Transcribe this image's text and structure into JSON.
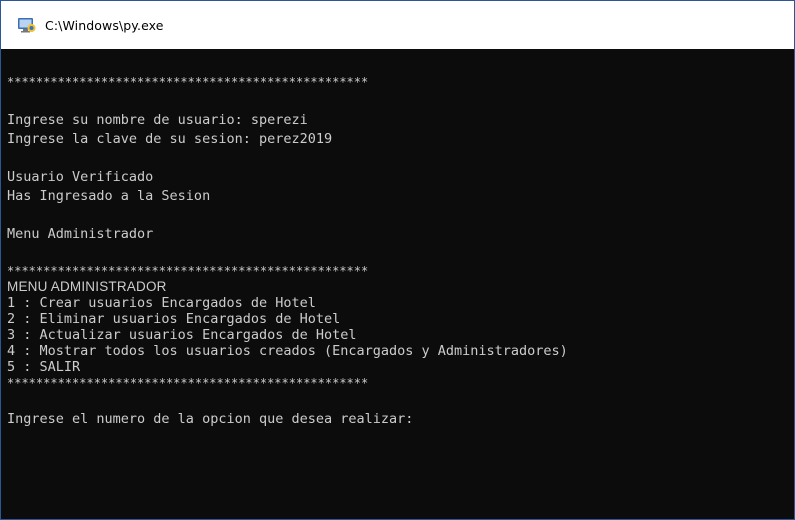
{
  "window": {
    "title": "C:\\Windows\\py.exe"
  },
  "console": {
    "stars_top": "**************************************************",
    "prompt_user": "Ingrese su nombre de usuario: sperezi",
    "prompt_pass": "Ingrese la clave de su sesion: perez2019",
    "verified": "Usuario Verificado",
    "session": "Has Ingresado a la Sesion",
    "menu_admin": "Menu Administrador",
    "stars_mid": "**************************************************",
    "menu_heading": "MENU ADMINISTRADOR",
    "options": [
      "1 : Crear usuarios Encargados de Hotel",
      "2 : Eliminar usuarios Encargados de Hotel",
      "3 : Actualizar usuarios Encargados de Hotel",
      "4 : Mostrar todos los usuarios creados (Encargados y Administradores)",
      "5 : SALIR"
    ],
    "stars_bottom": "**************************************************",
    "prompt_option": "Ingrese el numero de la opcion que desea realizar:"
  }
}
